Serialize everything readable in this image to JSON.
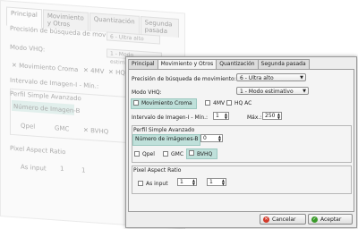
{
  "ghost": {
    "tabs": [
      "Principal",
      "Movimiento y Otros",
      "Quantización",
      "Segunda pasada"
    ],
    "precision_label": "Precisión de búsqueda de movimiento:",
    "precision_value": "6 - Ultra alto",
    "vhq_label": "Modo VHQ:",
    "vhq_value": "1 - Modo estimativo",
    "gmc_label": "Movimiento Croma",
    "mv4_label": "4MV",
    "hqac_label": "HQ AC",
    "interval_label": "Intervalo de Imagen-I - Mín.:",
    "perfil_label": "Perfil Simple Avanzado",
    "bframes_label": "Número de Imagen-B",
    "qpel_label": "Qpel",
    "gmc2_label": "GMC",
    "bvhq_label": "BVHQ",
    "par_label": "Pixel Aspect Ratio",
    "as_input_label": "As input",
    "par_a": "1",
    "par_b": "1"
  },
  "dialog": {
    "tabs": [
      {
        "label": "Principal",
        "active": false
      },
      {
        "label": "Movimiento y Otros",
        "active": true
      },
      {
        "label": "Quantización",
        "active": false
      },
      {
        "label": "Segunda pasada",
        "active": false
      }
    ],
    "precision": {
      "label": "Precisión de búsqueda de movimiento:",
      "value": "6 - Ultra alto"
    },
    "vhq": {
      "label": "Modo VHQ:",
      "value": "1 - Modo estimativo"
    },
    "checks": {
      "croma": "Movimiento Croma",
      "mv4": "4MV",
      "hqac": "HQ AC"
    },
    "interval": {
      "label": "Intervalo de Imagen-I - Mín.:",
      "min": "1",
      "max_label": "Máx.:",
      "max": "250"
    },
    "perfil": {
      "title": "Perfil Simple Avanzado",
      "bframes_label": "Número de imágenes-B",
      "bframes_value": "0",
      "qpel": "Qpel",
      "gmc": "GMC",
      "bvhq": "BVHQ"
    },
    "par": {
      "title": "Pixel Aspect Ratio",
      "as_input": "As input",
      "a": "1",
      "b": "1"
    },
    "buttons": {
      "cancel": "Cancelar",
      "accept": "Aceptar"
    }
  }
}
